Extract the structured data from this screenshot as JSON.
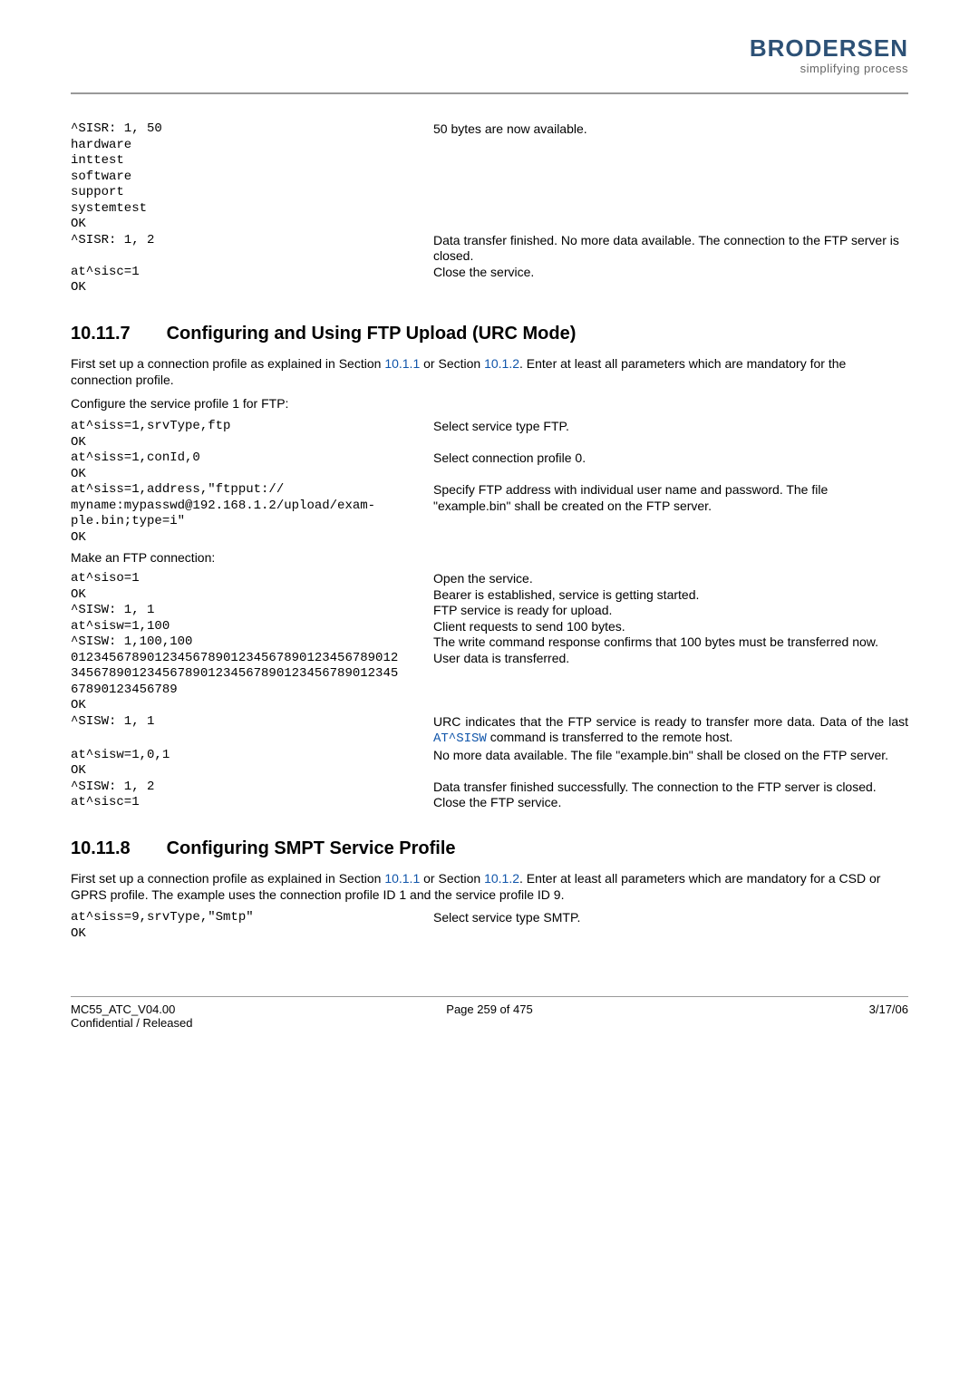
{
  "header": {
    "logo_text": "BRODERSEN",
    "tagline": "simplifying process"
  },
  "block1": {
    "rows": [
      {
        "left": "^SISR: 1, 50",
        "right": "50 bytes are now available."
      },
      {
        "left": "hardware",
        "right": ""
      },
      {
        "left": "inttest",
        "right": ""
      },
      {
        "left": "software",
        "right": ""
      },
      {
        "left": "support",
        "right": ""
      },
      {
        "left": "systemtest",
        "right": ""
      },
      {
        "left": "OK",
        "right": ""
      },
      {
        "left": "^SISR: 1, 2",
        "right": "Data transfer finished. No more data available. The connection to the FTP server is closed."
      },
      {
        "left": "at^sisc=1",
        "right": "Close the service."
      },
      {
        "left": "OK",
        "right": ""
      }
    ]
  },
  "section7": {
    "number": "10.11.7",
    "title": "Configuring and Using FTP Upload (URC Mode)",
    "intro_pre": "First set up a connection profile as explained in Section ",
    "link1": "10.1.1",
    "intro_mid": " or Section ",
    "link2": "10.1.2",
    "intro_post": ". Enter at least all parameters which are mandatory for the connection profile.",
    "configure_line": "Configure the service profile 1 for FTP:",
    "cfg_rows": [
      {
        "left": "at^siss=1,srvType,ftp",
        "right": "Select service type FTP."
      },
      {
        "left": "OK",
        "right": ""
      },
      {
        "left": "at^siss=1,conId,0",
        "right": "Select connection profile 0."
      },
      {
        "left": "OK",
        "right": ""
      },
      {
        "left": "at^siss=1,address,\"ftpput://\nmyname:mypasswd@192.168.1.2/upload/exam-\nple.bin;type=i\"",
        "right": "Specify FTP address with individual user name and password. The file \"example.bin\" shall be created on the FTP server."
      },
      {
        "left": "OK",
        "right": ""
      }
    ],
    "make_conn": "Make an FTP connection:",
    "conn_rows": [
      {
        "left": "at^siso=1",
        "right": "Open the service."
      },
      {
        "left": "OK",
        "right": "Bearer is established, service is getting started."
      },
      {
        "left": "^SISW: 1, 1",
        "right": "FTP service is ready for upload."
      },
      {
        "left": "at^sisw=1,100",
        "right": "Client requests to send 100 bytes."
      },
      {
        "left": "^SISW: 1,100,100",
        "right": "The write command response confirms that 100 bytes must be transferred now.",
        "justify": true
      },
      {
        "left": "0123456789012345678901234567890123456789012\n3456789012345678901234567890123456789012345\n67890123456789",
        "right": "User data is transferred."
      },
      {
        "left": "OK",
        "right": ""
      },
      {
        "left": "^SISW: 1, 1",
        "right_html": true,
        "right_pre": "URC indicates that the FTP service is ready to transfer more data. Data of the last ",
        "right_code": "AT^SISW",
        "right_post": " command is transferred to the remote host.",
        "justify": true
      },
      {
        "left": "at^sisw=1,0,1",
        "right": "No more data available. The file \"example.bin\" shall be closed on the FTP server.",
        "justify": true
      },
      {
        "left": "OK",
        "right": ""
      },
      {
        "left": "^SISW: 1, 2",
        "right": "Data transfer finished successfully. The connection to the FTP server is closed.",
        "justify": true
      },
      {
        "left": "at^sisc=1",
        "right": "Close the FTP service."
      }
    ]
  },
  "section8": {
    "number": "10.11.8",
    "title": "Configuring SMPT Service Profile",
    "intro_pre": "First set up a connection profile as explained in Section ",
    "link1": "10.1.1",
    "intro_mid": " or Section ",
    "link2": "10.1.2",
    "intro_post": ". Enter at least all parameters which are mandatory for a CSD or GPRS profile. The example uses the connection profile ID 1 and the service profile ID 9.",
    "rows": [
      {
        "left": "at^siss=9,srvType,\"Smtp\"",
        "right": "Select service type SMTP."
      },
      {
        "left": "OK",
        "right": ""
      }
    ]
  },
  "footer": {
    "left1": "MC55_ATC_V04.00",
    "left2": "Confidential / Released",
    "center": "Page 259 of 475",
    "right": "3/17/06"
  }
}
